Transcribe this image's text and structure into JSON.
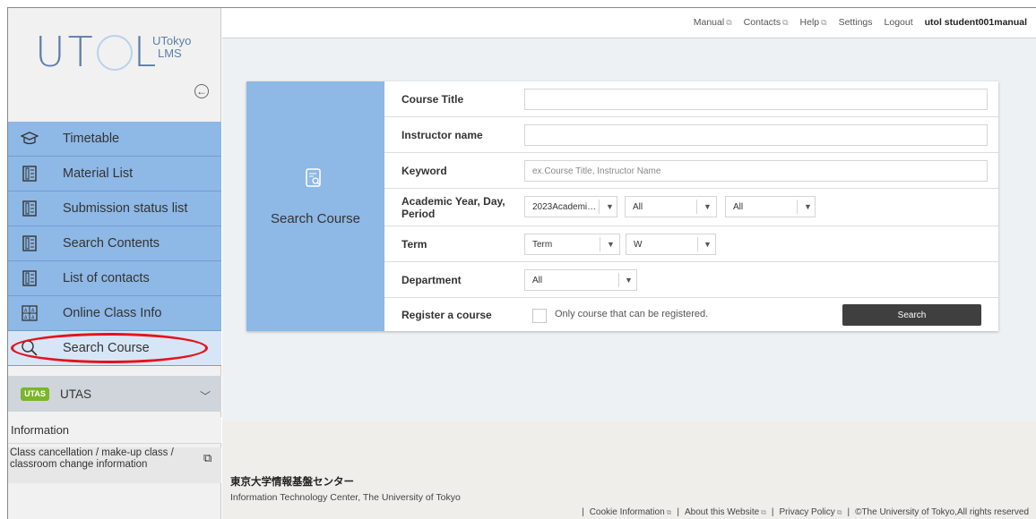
{
  "logo": {
    "mark": "UTOL",
    "sub_line1": "UTokyo",
    "sub_line2": "LMS"
  },
  "sidebar": {
    "items": [
      {
        "label": "Timetable",
        "icon": "mortarboard-icon"
      },
      {
        "label": "Material List",
        "icon": "document-list-icon"
      },
      {
        "label": "Submission status list",
        "icon": "document-list-icon"
      },
      {
        "label": "Search Contents",
        "icon": "document-list-icon"
      },
      {
        "label": "List of contacts",
        "icon": "document-list-icon"
      },
      {
        "label": "Online Class Info",
        "icon": "grid-icon"
      },
      {
        "label": "Search Course",
        "icon": "search-icon"
      }
    ],
    "utas": {
      "badge": "UTAS",
      "label": "UTAS"
    },
    "information_label": "Information",
    "info_link": "Class cancellation / make-up class / classroom change information"
  },
  "topbar": {
    "links": [
      "Manual",
      "Contacts",
      "Help",
      "Settings",
      "Logout"
    ],
    "user": "utol student001manual"
  },
  "search_panel": {
    "title": "Search Course",
    "rows": {
      "course_title": "Course Title",
      "instructor": "Instructor name",
      "keyword": "Keyword",
      "keyword_placeholder": "ex.Course Title, Instructor Name",
      "year_day_period": "Academic Year, Day, Period",
      "year_value": "2023Academi…",
      "day_value": "All",
      "period_value": "All",
      "term": "Term",
      "term_value": "Term",
      "term_value2": "W",
      "department": "Department",
      "department_value": "All",
      "register": "Register a course",
      "register_checkbox": "Only course that can be registered.",
      "search_button": "Search"
    }
  },
  "footer": {
    "org_jp": "東京大学情報基盤センター",
    "org_en": "Information Technology Center, The University of Tokyo",
    "links": [
      "Cookie Information",
      "About this Website",
      "Privacy Policy"
    ],
    "copyright": "©The University of Tokyo,All rights reserved"
  },
  "colors": {
    "accent": "#8eb8e6",
    "highlight": "#e5121c"
  }
}
